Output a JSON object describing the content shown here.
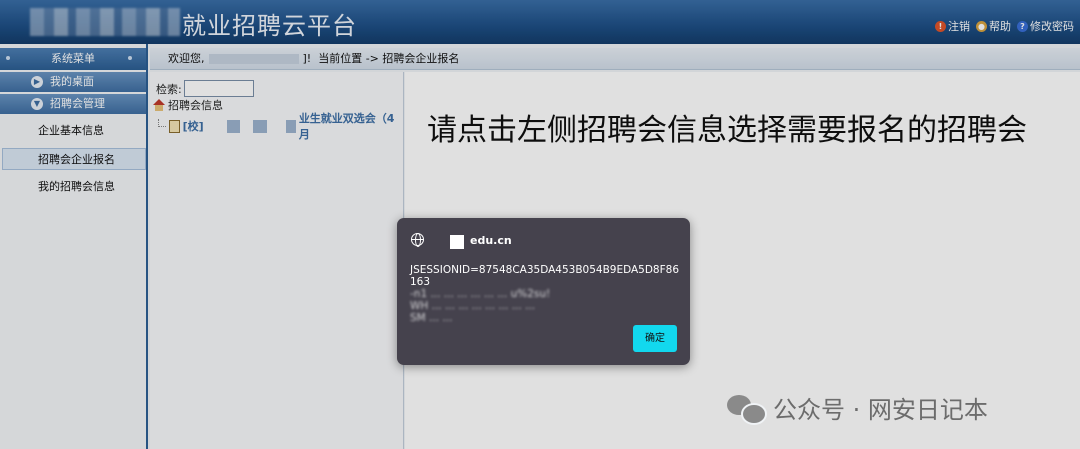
{
  "header": {
    "app_title": "就业招聘云平台",
    "links": [
      {
        "label": "注销",
        "icon": "logout-icon",
        "color": "#e0552b"
      },
      {
        "label": "帮助",
        "icon": "user-help-icon",
        "color": "#d9a441"
      },
      {
        "label": "修改密码",
        "icon": "question-icon",
        "color": "#3a6fd8"
      }
    ]
  },
  "sidebar": {
    "title": "系统菜单",
    "groups": [
      {
        "label": "我的桌面",
        "icon": "chevron-right-icon"
      },
      {
        "label": "招聘会管理",
        "icon": "chevron-down-icon"
      }
    ],
    "items": [
      {
        "label": "企业基本信息"
      },
      {
        "label": "招聘会企业报名"
      },
      {
        "label": "我的招聘会信息"
      }
    ]
  },
  "crumb": {
    "welcome": "欢迎您,",
    "name_suffix": "]!",
    "location": "当前位置 -> 招聘会企业报名"
  },
  "tree": {
    "search_label": "检索:",
    "search_value": "",
    "root_label": "招聘会信息",
    "child_prefix": "[校]",
    "child_text": "业生就业双选会（4月"
  },
  "main": {
    "message": "请点击左侧招聘会信息选择需要报名的招聘会"
  },
  "dialog": {
    "site": "edu.cn",
    "text_line1": "JSESSIONID=87548CA35DA453B054B9EDA5D8F86163",
    "text_line2": "-n1 ... ... ... ... ... ... u%2su!",
    "text_line3": "WH ... ... ... ... ... ... ... ...",
    "text_line4": "SM ... ...",
    "ok_label": "确定",
    "ok_color": "#12d8ee"
  },
  "watermark": {
    "text": "公众号 · 网安日记本"
  }
}
